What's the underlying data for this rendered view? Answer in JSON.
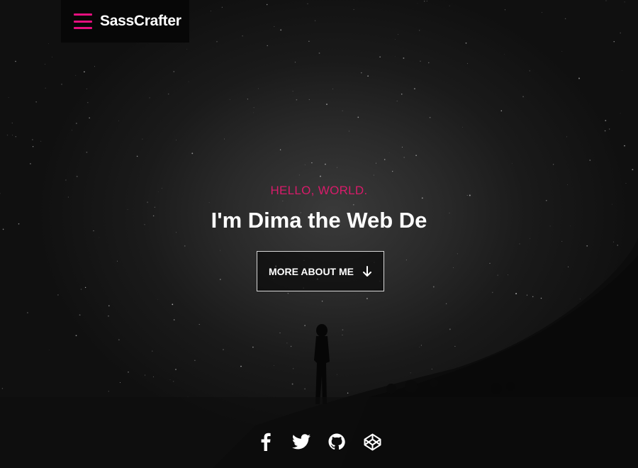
{
  "brand": {
    "name": "SassCrafter",
    "accent_color": "#e5107f",
    "menu_icon": "hamburger-menu-icon"
  },
  "hero": {
    "eyebrow": "HELLO, WORLD.",
    "eyebrow_color": "#d81b6a",
    "headline": "I'm Dima the Web De",
    "cta_label": "MORE ABOUT ME",
    "cta_icon": "arrow-down-icon",
    "background": "night sky with milky way and person silhouette"
  },
  "social": [
    {
      "name": "facebook",
      "icon": "facebook-icon"
    },
    {
      "name": "twitter",
      "icon": "twitter-icon"
    },
    {
      "name": "github",
      "icon": "github-icon"
    },
    {
      "name": "codepen",
      "icon": "codepen-icon"
    }
  ]
}
